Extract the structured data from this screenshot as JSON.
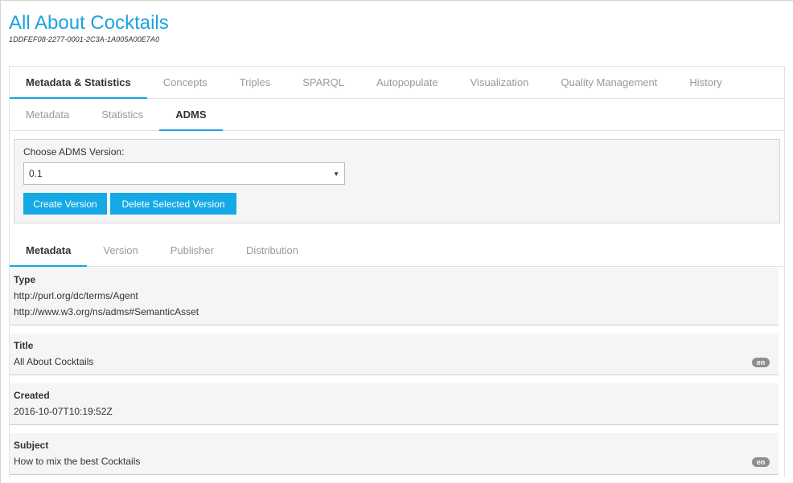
{
  "header": {
    "title": "All About Cocktails",
    "id": "1DDFEF08-2277-0001-2C3A-1A005A00E7A0"
  },
  "main_tabs": [
    {
      "label": "Metadata & Statistics",
      "active": true
    },
    {
      "label": "Concepts",
      "active": false
    },
    {
      "label": "Triples",
      "active": false
    },
    {
      "label": "SPARQL",
      "active": false
    },
    {
      "label": "Autopopulate",
      "active": false
    },
    {
      "label": "Visualization",
      "active": false
    },
    {
      "label": "Quality Management",
      "active": false
    },
    {
      "label": "History",
      "active": false
    }
  ],
  "sub_tabs": [
    {
      "label": "Metadata",
      "active": false
    },
    {
      "label": "Statistics",
      "active": false
    },
    {
      "label": "ADMS",
      "active": true
    }
  ],
  "adms": {
    "choose_label": "Choose ADMS Version:",
    "selected_version": "0.1",
    "caret": "▼",
    "create_label": "Create Version",
    "delete_label": "Delete Selected Version"
  },
  "meta_tabs": [
    {
      "label": "Metadata",
      "active": true
    },
    {
      "label": "Version",
      "active": false
    },
    {
      "label": "Publisher",
      "active": false
    },
    {
      "label": "Distribution",
      "active": false
    }
  ],
  "fields": {
    "type": {
      "label": "Type",
      "values": [
        "http://purl.org/dc/terms/Agent",
        "http://www.w3.org/ns/adms#SemanticAsset"
      ]
    },
    "title": {
      "label": "Title",
      "value": "All About Cocktails",
      "lang": "en"
    },
    "created": {
      "label": "Created",
      "value": "2016-10-07T10:19:52Z"
    },
    "subject": {
      "label": "Subject",
      "value": "How to mix the best Cocktails",
      "lang": "en"
    }
  },
  "colors": {
    "accent": "#1aa3e0",
    "button": "#15aae6",
    "field_bg": "#f5f5f5",
    "badge": "#8e8e8e"
  }
}
